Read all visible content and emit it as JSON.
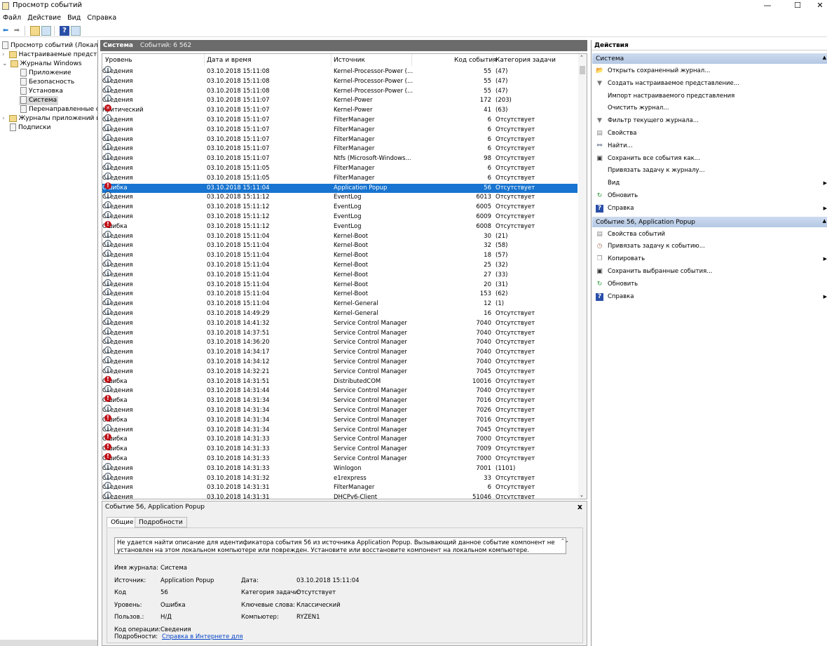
{
  "window": {
    "title": "Просмотр событий",
    "min": "—",
    "max": "☐",
    "close": "✕"
  },
  "menu": [
    "Файл",
    "Действие",
    "Вид",
    "Справка"
  ],
  "tree": {
    "root": "Просмотр событий (Локальный)",
    "custom": "Настраиваемые представления",
    "windows_logs": "Журналы Windows",
    "app": "Приложение",
    "security": "Безопасность",
    "setup": "Установка",
    "system": "Система",
    "forwarded": "Перенаправленные события",
    "app_logs": "Журналы приложений и служб",
    "subscriptions": "Подписки"
  },
  "center": {
    "log_name": "Система",
    "count": "Событий: 6 562",
    "columns": [
      "Уровень",
      "Дата и время",
      "Источник",
      "Код события",
      "Категория задачи"
    ],
    "selected_index": 12,
    "rows": [
      [
        "info",
        "Сведения",
        "03.10.2018 15:11:08",
        "Kernel-Processor-Power (...",
        "55",
        "(47)"
      ],
      [
        "info",
        "Сведения",
        "03.10.2018 15:11:08",
        "Kernel-Processor-Power (...",
        "55",
        "(47)"
      ],
      [
        "info",
        "Сведения",
        "03.10.2018 15:11:08",
        "Kernel-Processor-Power (...",
        "55",
        "(47)"
      ],
      [
        "info",
        "Сведения",
        "03.10.2018 15:11:07",
        "Kernel-Power",
        "172",
        "(203)"
      ],
      [
        "crit",
        "Критический",
        "03.10.2018 15:11:07",
        "Kernel-Power",
        "41",
        "(63)"
      ],
      [
        "info",
        "Сведения",
        "03.10.2018 15:11:07",
        "FilterManager",
        "6",
        "Отсутствует"
      ],
      [
        "info",
        "Сведения",
        "03.10.2018 15:11:07",
        "FilterManager",
        "6",
        "Отсутствует"
      ],
      [
        "info",
        "Сведения",
        "03.10.2018 15:11:07",
        "FilterManager",
        "6",
        "Отсутствует"
      ],
      [
        "info",
        "Сведения",
        "03.10.2018 15:11:07",
        "FilterManager",
        "6",
        "Отсутствует"
      ],
      [
        "info",
        "Сведения",
        "03.10.2018 15:11:07",
        "Ntfs (Microsoft-Windows...",
        "98",
        "Отсутствует"
      ],
      [
        "info",
        "Сведения",
        "03.10.2018 15:11:05",
        "FilterManager",
        "6",
        "Отсутствует"
      ],
      [
        "info",
        "Сведения",
        "03.10.2018 15:11:05",
        "FilterManager",
        "6",
        "Отсутствует"
      ],
      [
        "err",
        "Ошибка",
        "03.10.2018 15:11:04",
        "Application Popup",
        "56",
        "Отсутствует"
      ],
      [
        "info",
        "Сведения",
        "03.10.2018 15:11:12",
        "EventLog",
        "6013",
        "Отсутствует"
      ],
      [
        "info",
        "Сведения",
        "03.10.2018 15:11:12",
        "EventLog",
        "6005",
        "Отсутствует"
      ],
      [
        "info",
        "Сведения",
        "03.10.2018 15:11:12",
        "EventLog",
        "6009",
        "Отсутствует"
      ],
      [
        "err",
        "Ошибка",
        "03.10.2018 15:11:12",
        "EventLog",
        "6008",
        "Отсутствует"
      ],
      [
        "info",
        "Сведения",
        "03.10.2018 15:11:04",
        "Kernel-Boot",
        "30",
        "(21)"
      ],
      [
        "info",
        "Сведения",
        "03.10.2018 15:11:04",
        "Kernel-Boot",
        "32",
        "(58)"
      ],
      [
        "info",
        "Сведения",
        "03.10.2018 15:11:04",
        "Kernel-Boot",
        "18",
        "(57)"
      ],
      [
        "info",
        "Сведения",
        "03.10.2018 15:11:04",
        "Kernel-Boot",
        "25",
        "(32)"
      ],
      [
        "info",
        "Сведения",
        "03.10.2018 15:11:04",
        "Kernel-Boot",
        "27",
        "(33)"
      ],
      [
        "info",
        "Сведения",
        "03.10.2018 15:11:04",
        "Kernel-Boot",
        "20",
        "(31)"
      ],
      [
        "info",
        "Сведения",
        "03.10.2018 15:11:04",
        "Kernel-Boot",
        "153",
        "(62)"
      ],
      [
        "info",
        "Сведения",
        "03.10.2018 15:11:04",
        "Kernel-General",
        "12",
        "(1)"
      ],
      [
        "info",
        "Сведения",
        "03.10.2018 14:49:29",
        "Kernel-General",
        "16",
        "Отсутствует"
      ],
      [
        "info",
        "Сведения",
        "03.10.2018 14:41:32",
        "Service Control Manager",
        "7040",
        "Отсутствует"
      ],
      [
        "info",
        "Сведения",
        "03.10.2018 14:37:51",
        "Service Control Manager",
        "7040",
        "Отсутствует"
      ],
      [
        "info",
        "Сведения",
        "03.10.2018 14:36:20",
        "Service Control Manager",
        "7040",
        "Отсутствует"
      ],
      [
        "info",
        "Сведения",
        "03.10.2018 14:34:17",
        "Service Control Manager",
        "7040",
        "Отсутствует"
      ],
      [
        "info",
        "Сведения",
        "03.10.2018 14:34:12",
        "Service Control Manager",
        "7040",
        "Отсутствует"
      ],
      [
        "info",
        "Сведения",
        "03.10.2018 14:32:21",
        "Service Control Manager",
        "7045",
        "Отсутствует"
      ],
      [
        "err",
        "Ошибка",
        "03.10.2018 14:31:51",
        "DistributedCOM",
        "10016",
        "Отсутствует"
      ],
      [
        "info",
        "Сведения",
        "03.10.2018 14:31:44",
        "Service Control Manager",
        "7040",
        "Отсутствует"
      ],
      [
        "err",
        "Ошибка",
        "03.10.2018 14:31:34",
        "Service Control Manager",
        "7016",
        "Отсутствует"
      ],
      [
        "info",
        "Сведения",
        "03.10.2018 14:31:34",
        "Service Control Manager",
        "7026",
        "Отсутствует"
      ],
      [
        "err",
        "Ошибка",
        "03.10.2018 14:31:34",
        "Service Control Manager",
        "7016",
        "Отсутствует"
      ],
      [
        "info",
        "Сведения",
        "03.10.2018 14:31:34",
        "Service Control Manager",
        "7045",
        "Отсутствует"
      ],
      [
        "err",
        "Ошибка",
        "03.10.2018 14:31:33",
        "Service Control Manager",
        "7000",
        "Отсутствует"
      ],
      [
        "err",
        "Ошибка",
        "03.10.2018 14:31:33",
        "Service Control Manager",
        "7009",
        "Отсутствует"
      ],
      [
        "err",
        "Ошибка",
        "03.10.2018 14:31:33",
        "Service Control Manager",
        "7000",
        "Отсутствует"
      ],
      [
        "info",
        "Сведения",
        "03.10.2018 14:31:33",
        "Winlogon",
        "7001",
        "(1101)"
      ],
      [
        "info",
        "Сведения",
        "03.10.2018 14:31:32",
        "e1rexpress",
        "33",
        "Отсутствует"
      ],
      [
        "info",
        "Сведения",
        "03.10.2018 14:31:31",
        "FilterManager",
        "6",
        "Отсутствует"
      ],
      [
        "info",
        "Сведения",
        "03.10.2018 14:31:31",
        "DHCPv6-Client",
        "51046",
        "Отсутствует"
      ]
    ]
  },
  "detail": {
    "title": "Событие 56, Application Popup",
    "close": "x",
    "tabs": [
      "Общие",
      "Подробности"
    ],
    "description": "Не удается найти описание для идентификатора события 56 из источника Application Popup. Вызывающий данное событие компонент не установлен на этом локальном компьютере или поврежден. Установите или восстановите компонент на локальном компьютере.",
    "fields": {
      "log_label": "Имя журнала:",
      "log": "Система",
      "source_label": "Источник:",
      "source": "Application Popup",
      "date_label": "Дата:",
      "date": "03.10.2018 15:11:04",
      "code_label": "Код",
      "code": "56",
      "category_label": "Категория задачи:",
      "category": "Отсутствует",
      "level_label": "Уровень:",
      "level": "Ошибка",
      "keywords_label": "Ключевые слова:",
      "keywords": "Классический",
      "user_label": "Пользов.:",
      "user": "Н/Д",
      "computer_label": "Компьютер:",
      "computer": "RYZEN1",
      "opcode_label": "Код операции:",
      "opcode": "Сведения",
      "more_label": "Подробности:",
      "more_link": "Справка в Интернете для"
    }
  },
  "actions": {
    "title": "Действия",
    "section1": "Система",
    "items1": [
      {
        "icon": "open-folder",
        "label": "Открыть сохраненный журнал...",
        "sub": false
      },
      {
        "icon": "filter",
        "label": "Создать настраиваемое представление...",
        "sub": false
      },
      {
        "icon": "",
        "label": "Импорт настраиваемого представления",
        "sub": false
      },
      {
        "icon": "",
        "label": "Очистить журнал...",
        "sub": false
      },
      {
        "icon": "filter",
        "label": "Фильтр текущего журнала...",
        "sub": false
      },
      {
        "icon": "properties",
        "label": "Свойства",
        "sub": false
      },
      {
        "icon": "binoculars",
        "label": "Найти...",
        "sub": false
      },
      {
        "icon": "save",
        "label": "Сохранить все события как...",
        "sub": false
      },
      {
        "icon": "",
        "label": "Привязать задачу к журналу...",
        "sub": false
      },
      {
        "icon": "",
        "label": "Вид",
        "sub": true
      },
      {
        "icon": "refresh",
        "label": "Обновить",
        "sub": false
      },
      {
        "icon": "help",
        "label": "Справка",
        "sub": true
      }
    ],
    "section2": "Событие 56, Application Popup",
    "items2": [
      {
        "icon": "properties",
        "label": "Свойства событий",
        "sub": false
      },
      {
        "icon": "task",
        "label": "Привязать задачу к событию...",
        "sub": false
      },
      {
        "icon": "copy",
        "label": "Копировать",
        "sub": true
      },
      {
        "icon": "save",
        "label": "Сохранить выбранные события...",
        "sub": false
      },
      {
        "icon": "refresh",
        "label": "Обновить",
        "sub": false
      },
      {
        "icon": "help",
        "label": "Справка",
        "sub": true
      }
    ]
  },
  "colors": {
    "selection": "#1874d0",
    "header": "#6b6b6b",
    "error": "#c1121a",
    "link": "#0645c8"
  }
}
